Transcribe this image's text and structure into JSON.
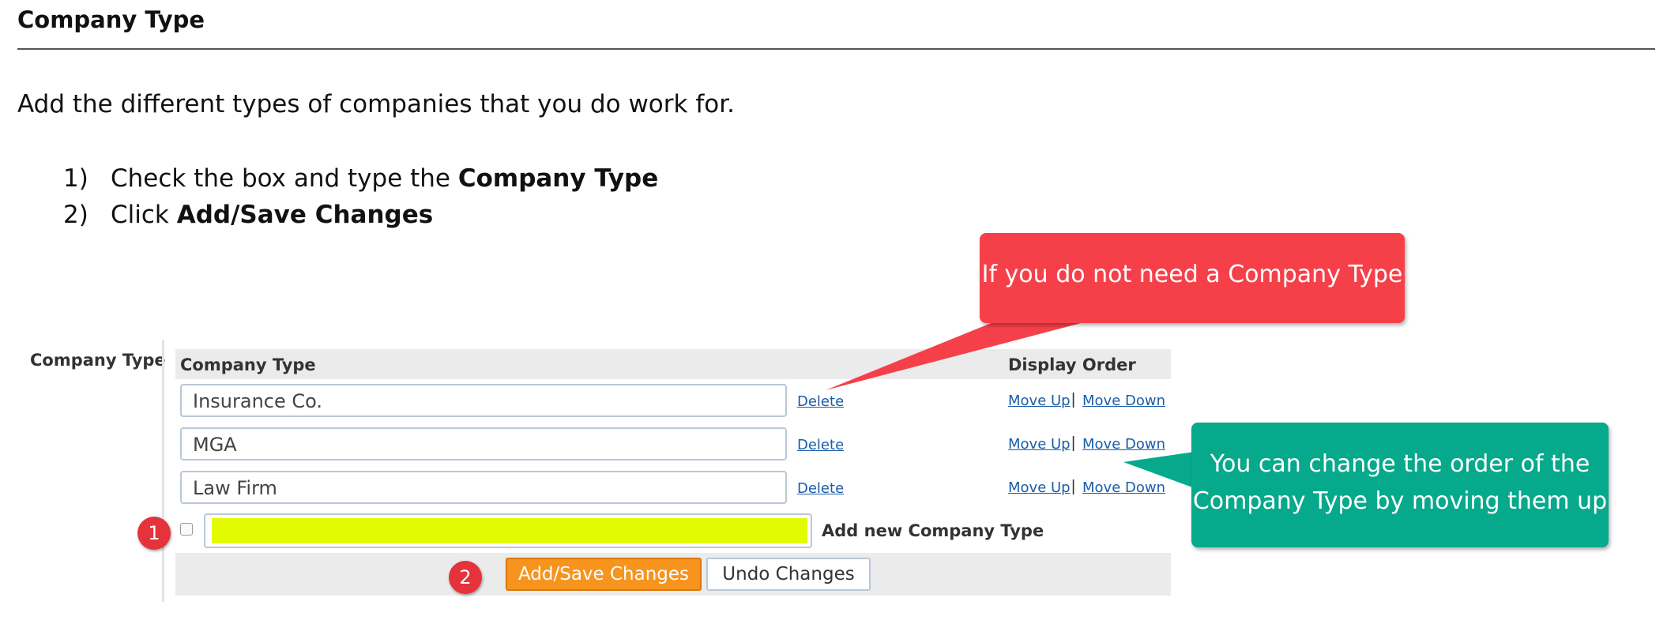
{
  "document": {
    "heading": "Company Type",
    "intro": "Add the different types of companies that you do work for.",
    "steps": [
      {
        "num": "1)",
        "text": "Check the box and type the ",
        "bold": "Company Type"
      },
      {
        "num": "2)",
        "text": "Click ",
        "bold": "Add/Save Changes"
      }
    ]
  },
  "form": {
    "section_label": "Company Type",
    "col_company_type": "Company Type",
    "col_display_order": "Display Order",
    "rows": [
      {
        "value": "Insurance Co.",
        "delete": "Delete",
        "move_up": "Move Up",
        "sep": "|",
        "move_down": "Move Down"
      },
      {
        "value": "MGA",
        "delete": "Delete",
        "move_up": "Move Up",
        "sep": "|",
        "move_down": "Move Down"
      },
      {
        "value": "Law Firm",
        "delete": "Delete",
        "move_up": "Move Up",
        "sep": "|",
        "move_down": "Move Down"
      }
    ],
    "new_label": "Add new Company Type",
    "save_button": "Add/Save Changes",
    "undo_button": "Undo Changes",
    "highlight_color": "#e2fb00"
  },
  "badges": {
    "one": "1",
    "two": "2"
  },
  "callouts": {
    "red": "If you do not need a Company Type",
    "green_line1": "You can change the order of the",
    "green_line2": "Company Type by moving them up",
    "red_color": "#f5404a",
    "green_color": "#06a98b"
  }
}
